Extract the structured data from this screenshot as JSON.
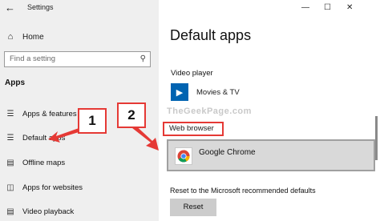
{
  "window": {
    "title": "Settings",
    "back_icon": "back-arrow-icon",
    "controls": [
      "—",
      "☐",
      "✕"
    ]
  },
  "sidebar": {
    "home_label": "Home",
    "search_placeholder": "Find a setting",
    "section_title": "Apps",
    "items": [
      {
        "label": "Apps & features",
        "icon": "apps-features-icon"
      },
      {
        "label": "Default apps",
        "icon": "default-apps-icon"
      },
      {
        "label": "Offline maps",
        "icon": "offline-maps-icon"
      },
      {
        "label": "Apps for websites",
        "icon": "apps-for-websites-icon"
      },
      {
        "label": "Video playback",
        "icon": "video-playback-icon"
      }
    ]
  },
  "main": {
    "title": "Default apps",
    "video_player_label": "Video player",
    "video_player_app": "Movies & TV",
    "web_browser_label": "Web browser",
    "web_browser_app": "Google Chrome",
    "reset_text": "Reset to the Microsoft recommended defaults",
    "reset_button": "Reset"
  },
  "annotations": {
    "step1": "1",
    "step2": "2",
    "watermark": "TheGeekPage.com",
    "accent_color": "#e53935"
  }
}
